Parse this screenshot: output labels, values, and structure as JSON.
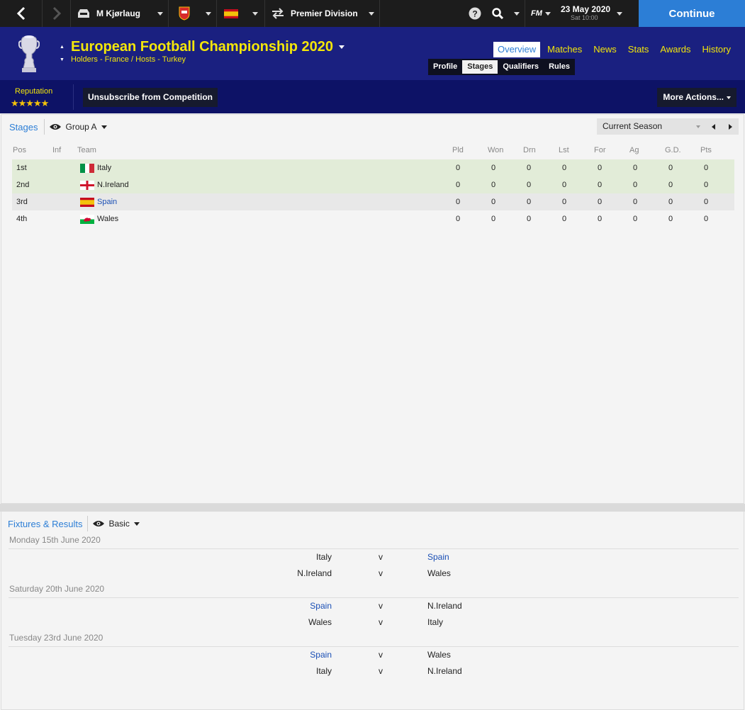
{
  "topbar": {
    "manager": "M Kjørlaug",
    "division": "Premier Division",
    "date": "23 May 2020",
    "time": "Sat 10:00",
    "fm_logo": "FM",
    "continue_label": "Continue",
    "icons": [
      "back-arrow-icon",
      "forward-arrow-icon",
      "inbox-icon",
      "club-badge-icon",
      "spain-flag-icon",
      "swap-arrows-icon",
      "help-icon",
      "search-icon"
    ]
  },
  "header": {
    "title": "European Football Championship 2020",
    "subtitle": "Holders - France / Hosts - Turkey",
    "main_tabs": [
      "Overview",
      "Matches",
      "News",
      "Stats",
      "Awards",
      "History"
    ],
    "active_main_tab": "Overview",
    "sub_tabs": [
      "Profile",
      "Stages",
      "Qualifiers",
      "Rules"
    ],
    "active_sub_tab": "Stages"
  },
  "actions": {
    "reputation_label": "Reputation",
    "reputation_stars": "★★★★★",
    "reputation_rating": 4.5,
    "unsubscribe_label": "Unsubscribe from Competition",
    "more_actions_label": "More Actions..."
  },
  "stages": {
    "panel_title": "Stages",
    "view": "Group A",
    "season": "Current Season",
    "columns": [
      "Pos",
      "Inf",
      "Team",
      "Pld",
      "Won",
      "Drn",
      "Lst",
      "For",
      "Ag",
      "G.D.",
      "Pts"
    ],
    "rows": [
      {
        "pos": "1st",
        "inf": "",
        "team": "Italy",
        "pld": "0",
        "won": "0",
        "drn": "0",
        "lst": "0",
        "for": "0",
        "ag": "0",
        "gd": "0",
        "pts": "0"
      },
      {
        "pos": "2nd",
        "inf": "",
        "team": "N.Ireland",
        "pld": "0",
        "won": "0",
        "drn": "0",
        "lst": "0",
        "for": "0",
        "ag": "0",
        "gd": "0",
        "pts": "0"
      },
      {
        "pos": "3rd",
        "inf": "",
        "team": "Spain",
        "pld": "0",
        "won": "0",
        "drn": "0",
        "lst": "0",
        "for": "0",
        "ag": "0",
        "gd": "0",
        "pts": "0"
      },
      {
        "pos": "4th",
        "inf": "",
        "team": "Wales",
        "pld": "0",
        "won": "0",
        "drn": "0",
        "lst": "0",
        "for": "0",
        "ag": "0",
        "gd": "0",
        "pts": "0"
      }
    ]
  },
  "fixtures": {
    "panel_title": "Fixtures & Results",
    "view": "Basic",
    "days": [
      {
        "date": "Monday 15th June 2020",
        "matches": [
          {
            "home": "Italy",
            "v": "v",
            "away": "Spain"
          },
          {
            "home": "N.Ireland",
            "v": "v",
            "away": "Wales"
          }
        ]
      },
      {
        "date": "Saturday 20th June 2020",
        "matches": [
          {
            "home": "Spain",
            "v": "v",
            "away": "N.Ireland"
          },
          {
            "home": "Wales",
            "v": "v",
            "away": "Italy"
          }
        ]
      },
      {
        "date": "Tuesday 23rd June 2020",
        "matches": [
          {
            "home": "Spain",
            "v": "v",
            "away": "Wales"
          },
          {
            "home": "Italy",
            "v": "v",
            "away": "N.Ireland"
          }
        ]
      }
    ]
  },
  "colors": {
    "accent": "#2c7ed6",
    "header_bg": "#1a2080",
    "title_yellow": "#f3e60a",
    "qualified_row": "#e2ecd8",
    "link": "#1a4fb5"
  }
}
